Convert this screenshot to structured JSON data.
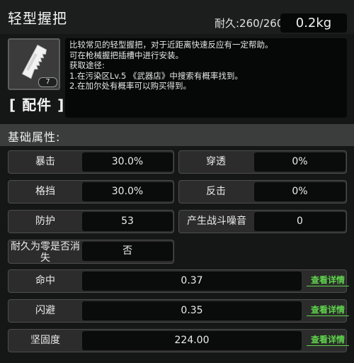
{
  "header": {
    "title": "轻型握把",
    "durability": "耐久:260/260",
    "weight": "0.2kg"
  },
  "item": {
    "icon": "grip-icon",
    "level": "7",
    "category": "[ 配件 ]"
  },
  "description": [
    "比较常见的轻型握把，对于近距离快速反应有一定帮助。",
    "可在枪械握把插槽中进行安装。",
    "获取途径:",
    "1.在污染区Lv.5 《武器店》中搜索有概率找到。",
    "2.在加尔处有概率可以购买得到。"
  ],
  "section": {
    "title": "基础属性:"
  },
  "stats": [
    {
      "label": "暴击",
      "value": "30.0%"
    },
    {
      "label": "穿透",
      "value": "0%"
    },
    {
      "label": "格挡",
      "value": "30.0%"
    },
    {
      "label": "反击",
      "value": "0%"
    },
    {
      "label": "防护",
      "value": "53"
    },
    {
      "label": "产生战斗噪音",
      "value": "0"
    },
    {
      "label_line1": "耐久为零是否消",
      "label_line2": "失",
      "value": "否"
    }
  ],
  "wide_stats": [
    {
      "label": "命中",
      "value": "0.37",
      "action": "查看详情"
    },
    {
      "label": "闪避",
      "value": "0.35",
      "action": "查看详情"
    },
    {
      "label": "坚固度",
      "value": "224.00",
      "action": "查看详情"
    }
  ],
  "colors": {
    "background": "#151716",
    "panel": "#2b2c2b",
    "value_box": "#0a0b0b",
    "link_green": "#5fd44c"
  }
}
